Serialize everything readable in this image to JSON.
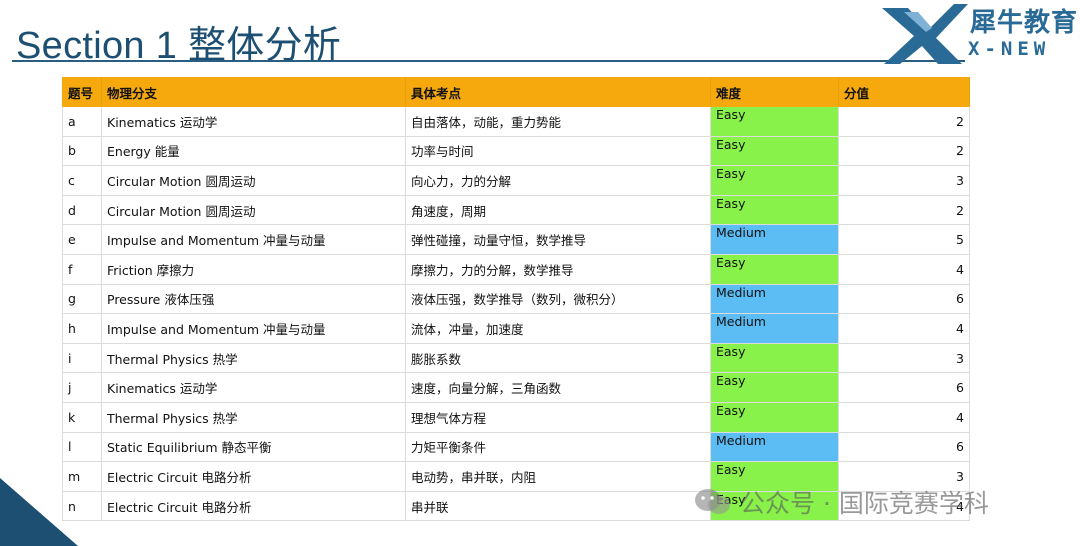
{
  "header": {
    "title": "Section 1 整体分析",
    "logo_cn": "犀牛教育",
    "logo_en": "X-NEW"
  },
  "table": {
    "headers": [
      "题号",
      "物理分支",
      "具体考点",
      "难度",
      "分值"
    ],
    "rows": [
      {
        "id": "a",
        "branch": "Kinematics 运动学",
        "topic": "自由落体，动能，重力势能",
        "difficulty": "Easy",
        "score": "2"
      },
      {
        "id": "b",
        "branch": "Energy 能量",
        "topic": "功率与时间",
        "difficulty": "Easy",
        "score": "2"
      },
      {
        "id": "c",
        "branch": "Circular Motion 圆周运动",
        "topic": "向心力，力的分解",
        "difficulty": "Easy",
        "score": "3"
      },
      {
        "id": "d",
        "branch": "Circular Motion 圆周运动",
        "topic": "角速度，周期",
        "difficulty": "Easy",
        "score": "2"
      },
      {
        "id": "e",
        "branch": "Impulse and Momentum 冲量与动量",
        "topic": "弹性碰撞，动量守恒，数学推导",
        "difficulty": "Medium",
        "score": "5"
      },
      {
        "id": "f",
        "branch": "Friction 摩擦力",
        "topic": "摩擦力，力的分解，数学推导",
        "difficulty": "Easy",
        "score": "4"
      },
      {
        "id": "g",
        "branch": "Pressure 液体压强",
        "topic": "液体压强，数学推导（数列，微积分）",
        "difficulty": "Medium",
        "score": "6"
      },
      {
        "id": "h",
        "branch": "Impulse and Momentum 冲量与动量",
        "topic": "流体，冲量，加速度",
        "difficulty": "Medium",
        "score": "4"
      },
      {
        "id": "i",
        "branch": "Thermal Physics 热学",
        "topic": "膨胀系数",
        "difficulty": "Easy",
        "score": "3"
      },
      {
        "id": "j",
        "branch": "Kinematics 运动学",
        "topic": "速度，向量分解，三角函数",
        "difficulty": "Easy",
        "score": "6"
      },
      {
        "id": "k",
        "branch": "Thermal Physics 热学",
        "topic": "理想气体方程",
        "difficulty": "Easy",
        "score": "4"
      },
      {
        "id": "l",
        "branch": "Static Equilibrium 静态平衡",
        "topic": "力矩平衡条件",
        "difficulty": "Medium",
        "score": "6"
      },
      {
        "id": "m",
        "branch": "Electric Circuit 电路分析",
        "topic": "电动势，串并联，内阻",
        "difficulty": "Easy",
        "score": "3"
      },
      {
        "id": "n",
        "branch": "Electric Circuit 电路分析",
        "topic": "串并联",
        "difficulty": "Easy",
        "score": "4"
      }
    ]
  },
  "watermark": {
    "text": "公众号 · 国际竞赛学科",
    "icon": "wechat-icon"
  },
  "colors": {
    "title": "#1d4f73",
    "header_bg": "#f5a90d",
    "easy": "#88f24a",
    "medium": "#5cbcf4",
    "brand": "#2a6a96"
  }
}
